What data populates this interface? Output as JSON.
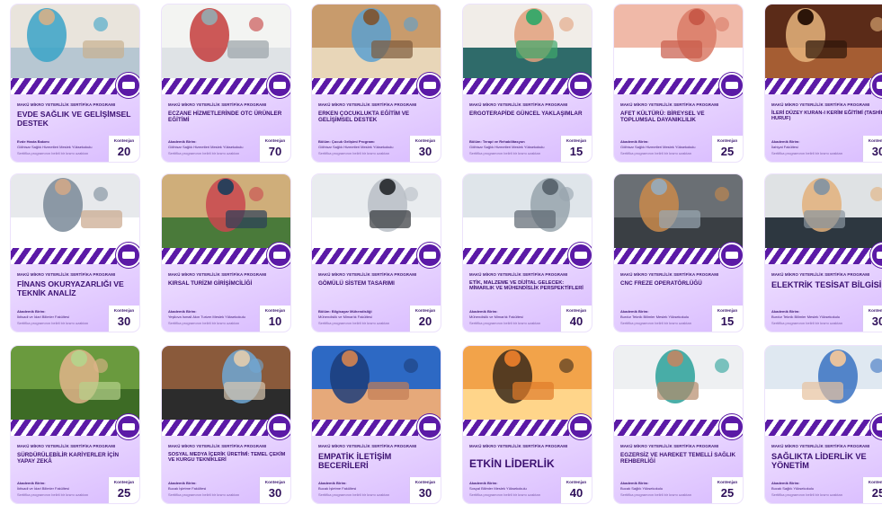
{
  "eyebrow": "MAKÜ MİKRO YETERLİLİK SERTİFİKA PROGRAMI",
  "quota_label": "Kontenjan",
  "colors": {
    "brand_purple": "#5b1aa6",
    "title_purple": "#3b1070",
    "card_bg": "#ead8ff"
  },
  "cards": [
    {
      "title": "EVDE SAĞLIK VE GELİŞİMSEL DESTEK",
      "line1": "Evde Hasta Bakımı",
      "line2": "Gölhisar Sağlık Hizmetleri Meslek Yüksekokulu",
      "note": "Sertifika programının belirli bir kısmı uzaktan",
      "quota": "20",
      "photo": "home-care-photo"
    },
    {
      "title": "ECZANE HİZMETLERİNDE OTC ÜRÜNLER EĞİTİMİ",
      "line1": "Akademik Birim:",
      "line2": "Gölhisar Sağlık Hizmetleri Meslek Yüksekokulu",
      "note": "Sertifika programının belirli bir kısmı uzaktan",
      "quota": "70",
      "photo": "pharmacy-photo"
    },
    {
      "title": "ERKEN ÇOCUKLUKTA EĞİTİM VE GELİŞİMSEL DESTEK",
      "line1": "Bölüm: Çocuk Gelişimi Programı",
      "line2": "Gölhisar Sağlık Hizmetleri Meslek Yüksekokulu",
      "note": "Sertifika programının belirli bir kısmı uzaktan",
      "quota": "30",
      "photo": "children-play-photo"
    },
    {
      "title": "ERGOTERAPİDE GÜNCEL YAKLAŞIMLAR",
      "line1": "Bölüm: Terapi ve Rehabilitasyon",
      "line2": "Gölhisar Sağlık Hizmetleri Meslek Yüksekokulu",
      "note": "Sertifika programının belirli bir kısmı uzaktan",
      "quota": "15",
      "photo": "therapy-photo"
    },
    {
      "title": "AFET KÜLTÜRÜ: BİREYSEL VE TOPLUMSAL DAYANIKLILIK",
      "line1": "Akademik Birim:",
      "line2": "Gölhisar Sağlık Hizmetleri Meslek Yüksekokulu",
      "note": "Sertifika programının belirli bir kısmı uzaktan",
      "quota": "25",
      "photo": "hands-people-photo"
    },
    {
      "title": "İLERİ DÜZEY KURAN-I KERİM EĞİTİMİ (TASHİH-İ HURUF)",
      "line1": "Akademik Birim:",
      "line2": "İlahiyat Fakültesi",
      "note": "Sertifika programının belirli bir kısmı uzaktan",
      "quota": "30",
      "photo": "book-photo"
    },
    {
      "title": "FİNANS OKURYAZARLIĞI VE TEKNİK ANALİZ",
      "line1": "Akademik Birim:",
      "line2": "İktisadi ve İdari Bilimler Fakültesi",
      "note": "Sertifika programının belirli bir kısmı uzaktan",
      "quota": "30",
      "photo": "finance-photo"
    },
    {
      "title": "KIRSAL TURİZM GİRİŞİMCİLİĞİ",
      "line1": "Akademik Birim:",
      "line2": "Yeşilova İsmail Akın Turizm Meslek Yüksekokulu",
      "note": "Sertifika programının belirli bir kısmı uzaktan",
      "quota": "10",
      "photo": "tourists-photo"
    },
    {
      "title": "GÖMÜLÜ SİSTEM TASARIMI",
      "line1": "Bölüm: Bilgisayar Mühendisliği",
      "line2": "Mühendislik ve Mimarlık Fakültesi",
      "note": "Sertifika programının belirli bir kısmı uzaktan",
      "quota": "20",
      "photo": "laptop-photo"
    },
    {
      "title": "ETİK, MALZEME VE DİJİTAL GELECEK: MİMARLIK VE MÜHENDİSLİK PERSPEKTİFLERİ",
      "line1": "Akademik Birim:",
      "line2": "Mühendislik ve Mimarlık Fakültesi",
      "note": "Sertifika programının belirli bir kısmı uzaktan",
      "quota": "40",
      "photo": "architecture-photo"
    },
    {
      "title": "CNC FREZE OPERATÖRLÜĞÜ",
      "line1": "Akademik Birim:",
      "line2": "Burdur Teknik Bilimler Meslek Yüksekokulu",
      "note": "Sertifika programının belirli bir kısmı uzaktan",
      "quota": "15",
      "photo": "cnc-operator-photo"
    },
    {
      "title": "ELEKTRİK TESİSAT BİLGİSİ",
      "line1": "Akademik Birim:",
      "line2": "Burdur Teknik Bilimler Meslek Yüksekokulu",
      "note": "Sertifika programının belirli bir kısmı uzaktan",
      "quota": "30",
      "photo": "electric-panel-photo"
    },
    {
      "title": "SÜRDÜRÜLEBİLİR KARİYERLER İÇİN YAPAY ZEKÂ",
      "line1": "Akademik Birim:",
      "line2": "İktisadi ve İdari Bilimler Fakültesi",
      "note": "Sertifika programının belirli bir kısmı uzaktan",
      "quota": "25",
      "photo": "tablet-field-photo"
    },
    {
      "title": "SOSYAL MEDYA İÇERİK ÜRETİMİ: TEMEL ÇEKİM VE KURGU TEKNİKLERİ",
      "line1": "Akademik Birim:",
      "line2": "Bucak İşletme Fakültesi",
      "note": "Sertifika programının belirli bir kısmı uzaktan",
      "quota": "30",
      "photo": "camera-photo"
    },
    {
      "title": "EMPATİK İLETİŞİM BECERİLERİ",
      "line1": "Akademik Birim:",
      "line2": "Bucak İşletme Fakültesi",
      "note": "Sertifika programının belirli bir kısmı uzaktan",
      "quota": "30",
      "photo": "holding-hands-photo"
    },
    {
      "title": "ETKİN LİDERLİK",
      "line1": "Akademik Birim:",
      "line2": "Sosyal Bilimler Meslek Yüksekokulu",
      "note": "Sertifika programının belirli bir kısmı uzaktan",
      "quota": "40",
      "photo": "leader-summit-photo"
    },
    {
      "title": "EGZERSİZ VE HAREKET TEMELLİ SAĞLIK REHBERLİĞİ",
      "line1": "Akademik Birim:",
      "line2": "Bucak Sağlık Yüksekokulu",
      "note": "Sertifika programının belirli bir kısmı uzaktan",
      "quota": "25",
      "photo": "exercise-photo"
    },
    {
      "title": "SAĞLIKTA LİDERLİK VE YÖNETİM",
      "line1": "Akademik Birim:",
      "line2": "Bucak Sağlık Yüksekokulu",
      "note": "Sertifika programının belirli bir kısmı uzaktan",
      "quota": "25",
      "photo": "health-management-photo"
    }
  ]
}
